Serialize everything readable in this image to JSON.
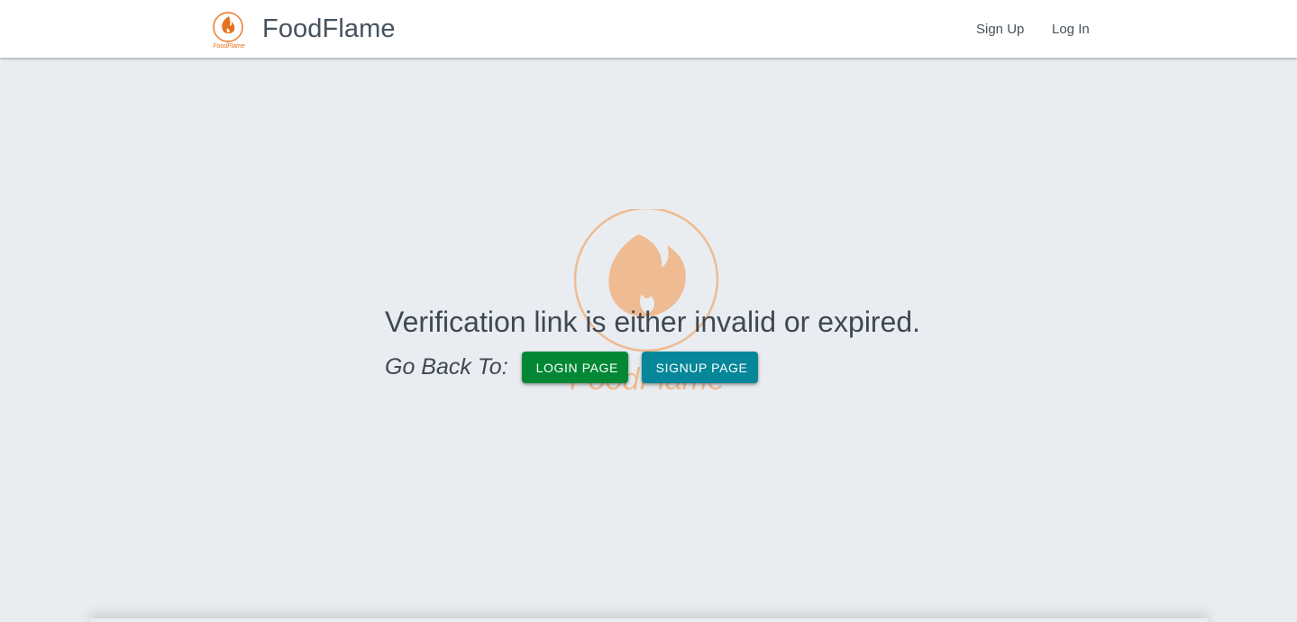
{
  "navbar": {
    "logo_icon": "flame-icon",
    "logo_text": "FoodFlame",
    "brand_name": "FoodFlame",
    "links": {
      "signup": "Sign Up",
      "login": "Log In"
    }
  },
  "main": {
    "message": "Verification link is either invalid or expired.",
    "go_back_label": "Go Back To:",
    "buttons": {
      "login": "LOGIN PAGE",
      "signup": "SIGNUP PAGE"
    },
    "watermark_text": "FoodFlame",
    "watermark_icon": "flame-icon"
  },
  "colors": {
    "brand_orange": "#e8701a",
    "login_button": "#028835",
    "signup_button": "#058699",
    "background": "#e9edf1",
    "text": "#3e4853"
  }
}
